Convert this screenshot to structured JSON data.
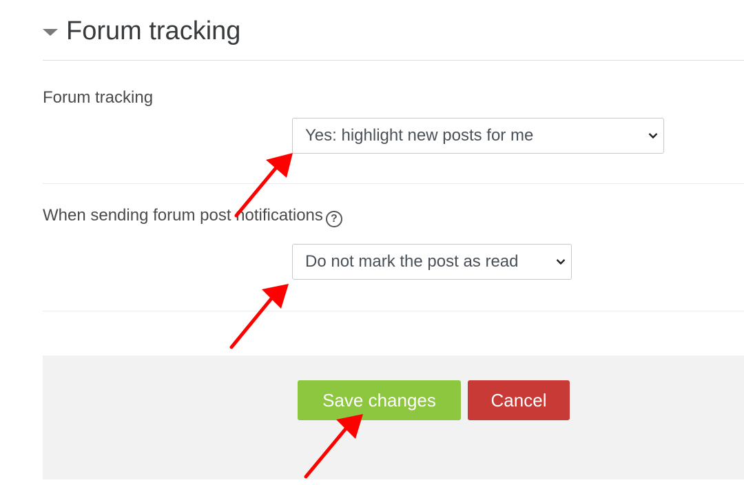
{
  "section": {
    "title": "Forum tracking",
    "collapse_icon": "chevron-down-icon"
  },
  "fields": {
    "tracking": {
      "label": "Forum tracking",
      "value": "Yes: highlight new posts for me"
    },
    "notifications": {
      "label": "When sending forum post notifications",
      "help_icon": "question-circle-icon",
      "help_glyph": "?",
      "value": "Do not mark the post as read"
    }
  },
  "actions": {
    "save_label": "Save changes",
    "cancel_label": "Cancel"
  },
  "colors": {
    "save_button": "#8dc63f",
    "cancel_button": "#c73a36",
    "annotation_arrow": "#ff0000",
    "footer_background": "#f2f2f2"
  }
}
